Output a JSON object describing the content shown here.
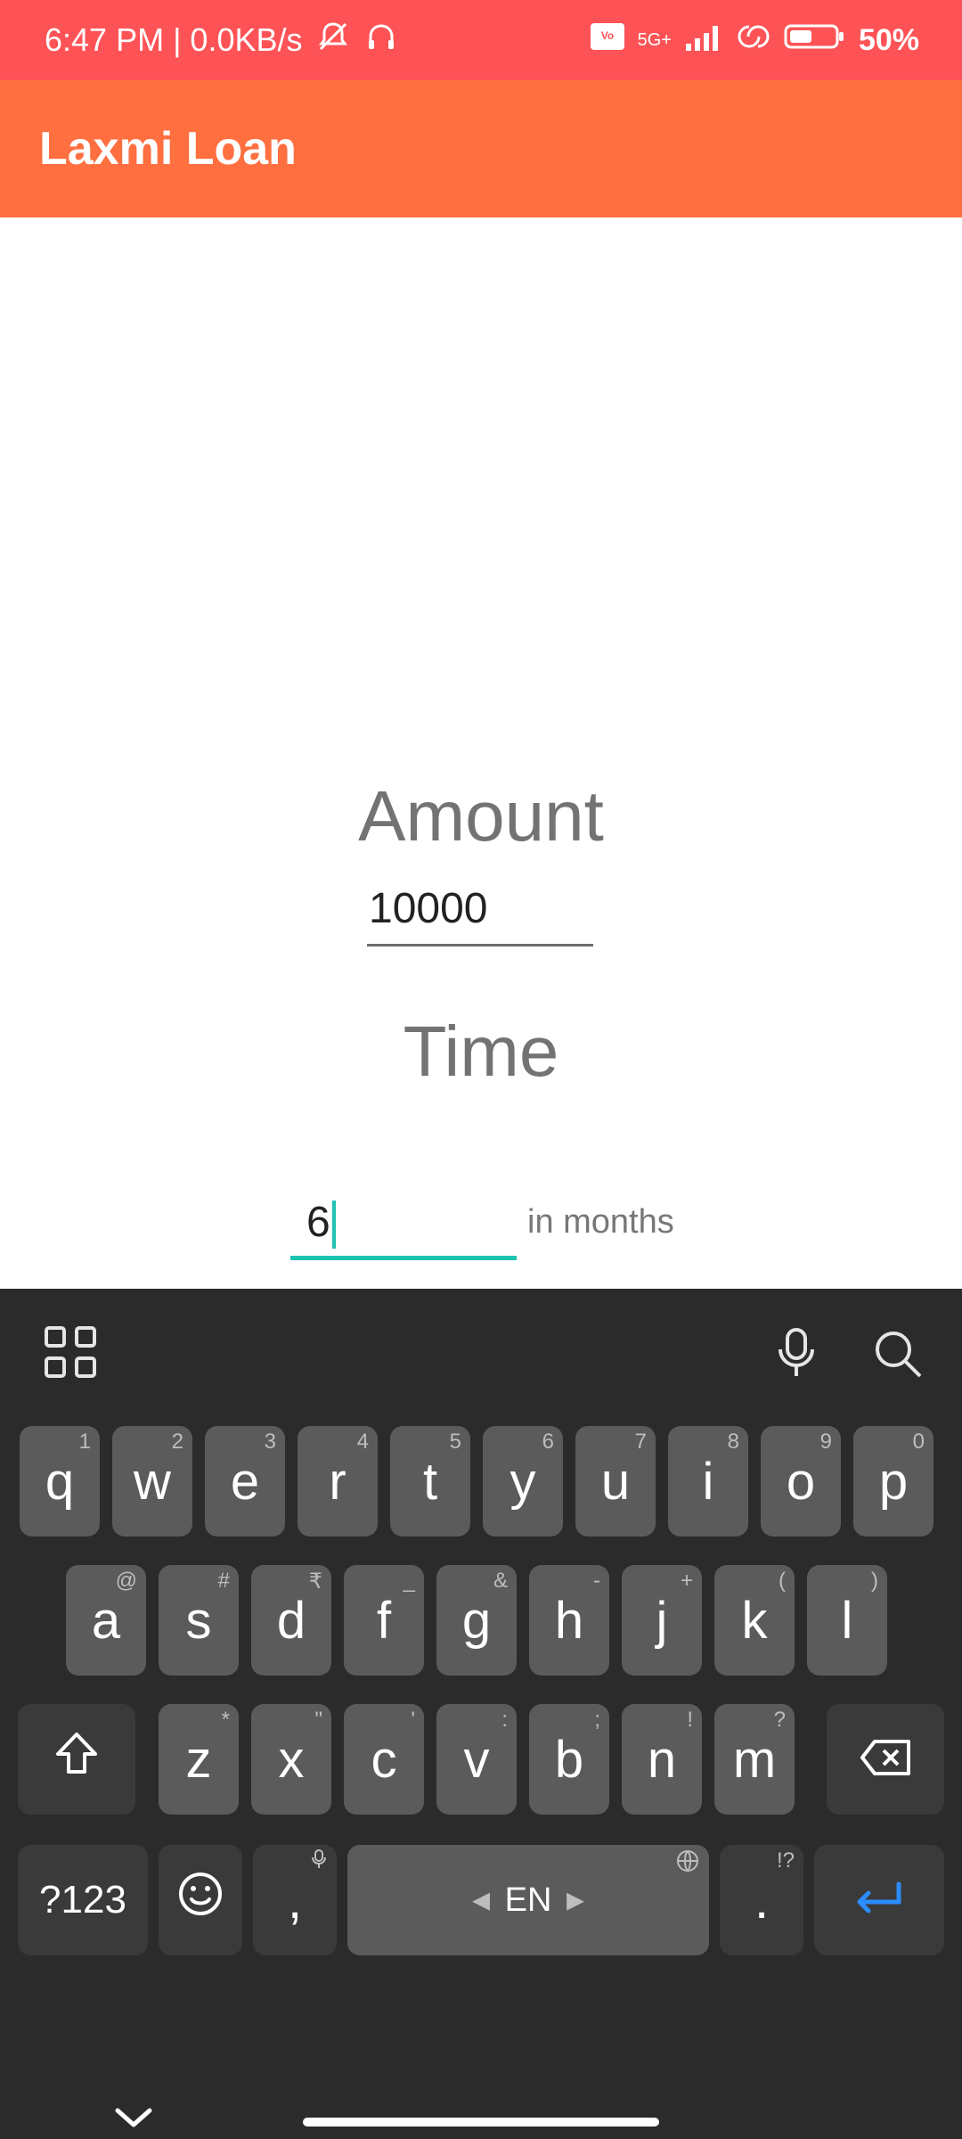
{
  "status": {
    "time_speed": "6:47 PM | 0.0KB/s",
    "battery_percent": "50%",
    "network": "5G+"
  },
  "app": {
    "title": "Laxmi Loan"
  },
  "form": {
    "amount_label": "Amount",
    "amount_value": "10000",
    "time_label": "Time",
    "time_value": "6",
    "time_unit": "in months"
  },
  "keyboard": {
    "row1": [
      {
        "k": "q",
        "h": "1"
      },
      {
        "k": "w",
        "h": "2"
      },
      {
        "k": "e",
        "h": "3"
      },
      {
        "k": "r",
        "h": "4"
      },
      {
        "k": "t",
        "h": "5"
      },
      {
        "k": "y",
        "h": "6"
      },
      {
        "k": "u",
        "h": "7"
      },
      {
        "k": "i",
        "h": "8"
      },
      {
        "k": "o",
        "h": "9"
      },
      {
        "k": "p",
        "h": "0"
      }
    ],
    "row2": [
      {
        "k": "a",
        "h": "@"
      },
      {
        "k": "s",
        "h": "#"
      },
      {
        "k": "d",
        "h": "₹"
      },
      {
        "k": "f",
        "h": "_"
      },
      {
        "k": "g",
        "h": "&"
      },
      {
        "k": "h",
        "h": "-"
      },
      {
        "k": "j",
        "h": "+"
      },
      {
        "k": "k",
        "h": "("
      },
      {
        "k": "l",
        "h": ")"
      }
    ],
    "row3": [
      {
        "k": "z",
        "h": "*"
      },
      {
        "k": "x",
        "h": "\""
      },
      {
        "k": "c",
        "h": "'"
      },
      {
        "k": "v",
        "h": ":"
      },
      {
        "k": "b",
        "h": ";"
      },
      {
        "k": "n",
        "h": "!"
      },
      {
        "k": "m",
        "h": "?"
      }
    ],
    "symbols_label": "?123",
    "comma_label": ",",
    "space_label": "EN",
    "period_label": ".",
    "period_hint": "!?"
  }
}
